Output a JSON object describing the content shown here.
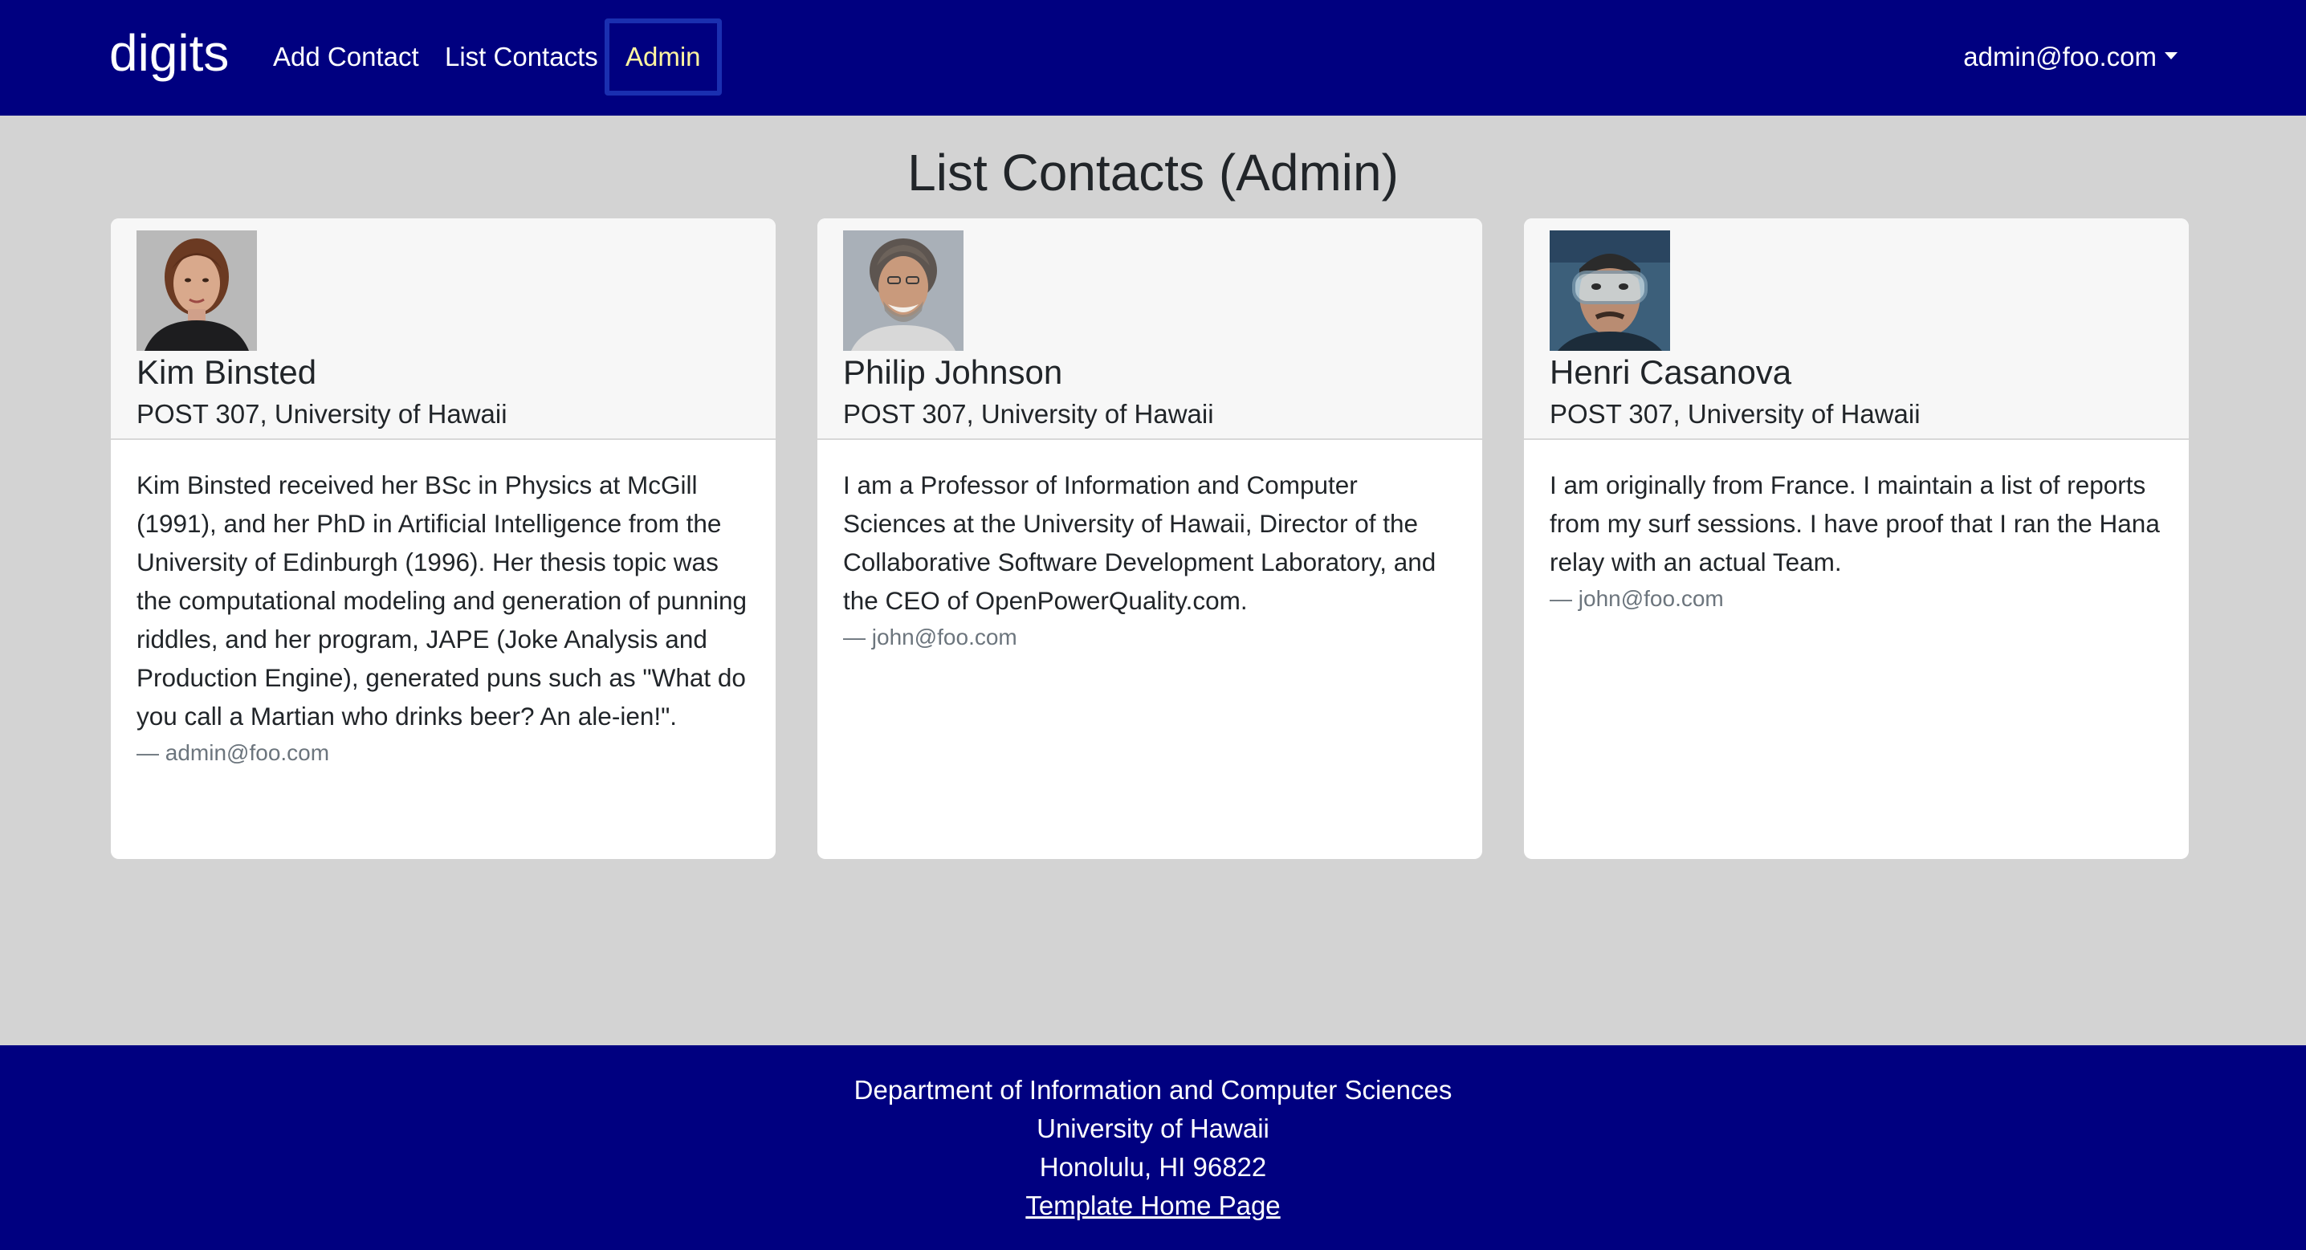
{
  "navbar": {
    "brand": "digits",
    "links": [
      {
        "label": "Add Contact"
      },
      {
        "label": "List Contacts"
      },
      {
        "label": "Admin"
      }
    ],
    "user": "admin@foo.com"
  },
  "page": {
    "title": "List Contacts (Admin)"
  },
  "contacts": [
    {
      "name": "Kim Binsted",
      "address": "POST 307, University of Hawaii",
      "description": "Kim Binsted received her BSc in Physics at McGill (1991), and her PhD in Artificial Intelligence from the University of Edinburgh (1996). Her thesis topic was the computational modeling and generation of punning riddles, and her program, JAPE (Joke Analysis and Production Engine), generated puns such as \"What do you call a Martian who drinks beer? An ale-ien!\".",
      "owner": "— admin@foo.com"
    },
    {
      "name": "Philip Johnson",
      "address": "POST 307, University of Hawaii",
      "description": "I am a Professor of Information and Computer Sciences at the University of Hawaii, Director of the Collaborative Software Development Laboratory, and the CEO of OpenPowerQuality.com.",
      "owner": "— john@foo.com"
    },
    {
      "name": "Henri Casanova",
      "address": "POST 307, University of Hawaii",
      "description": "I am originally from France. I maintain a list of reports from my surf sessions. I have proof that I ran the Hana relay with an actual Team.",
      "owner": "— john@foo.com"
    }
  ],
  "footer": {
    "line1": "Department of Information and Computer Sciences",
    "line2": "University of Hawaii",
    "line3": "Honolulu, HI 96822",
    "link": "Template Home Page"
  }
}
